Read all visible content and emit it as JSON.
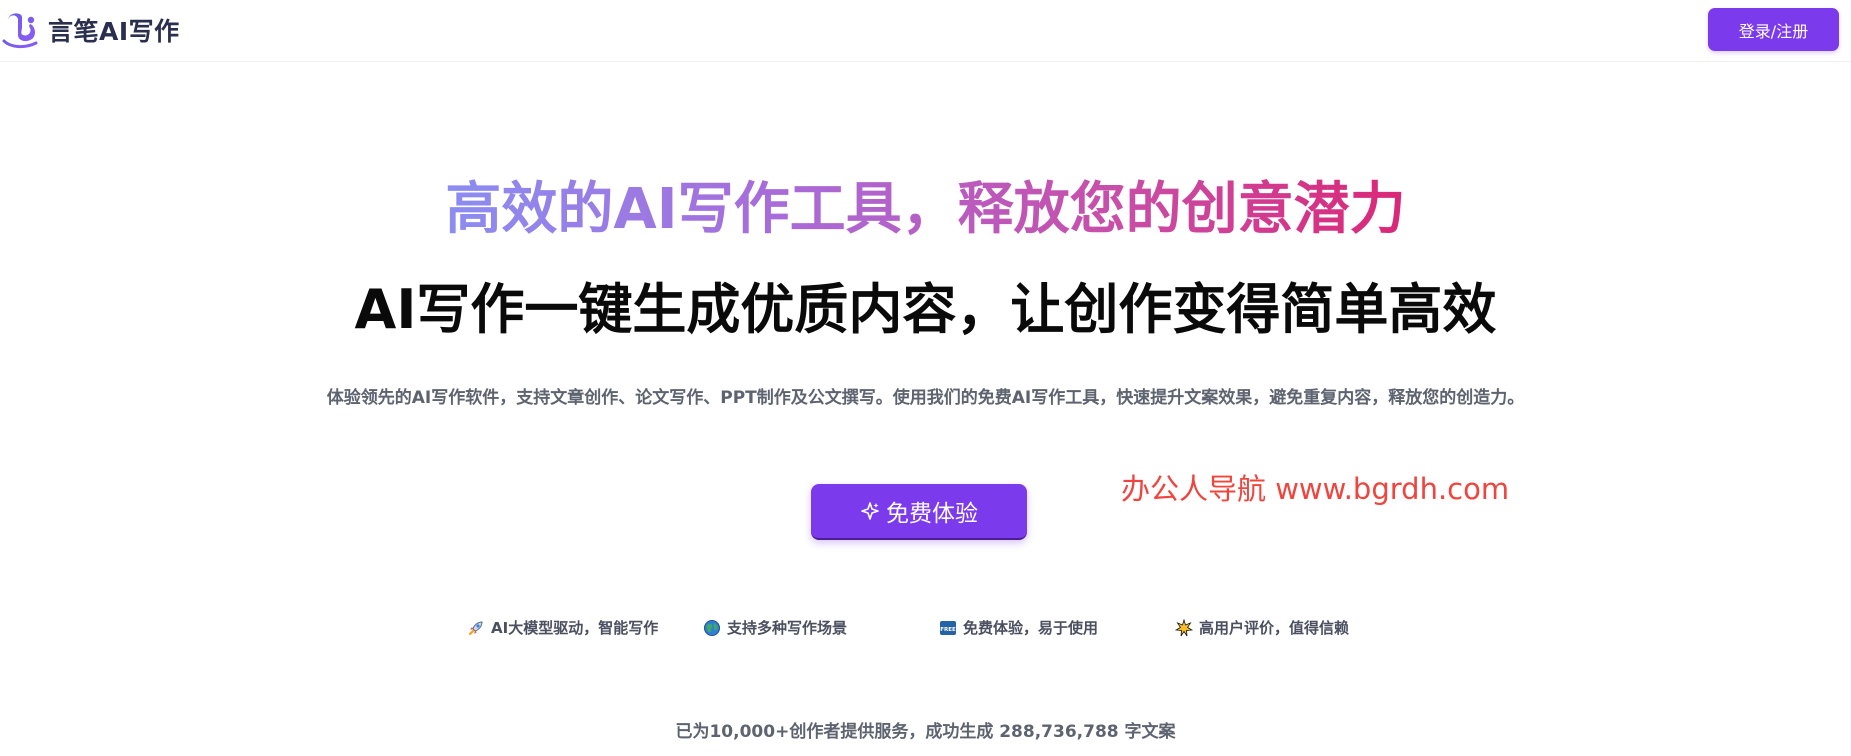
{
  "header": {
    "logo_text": "言笔AI写作",
    "login_label": "登录/注册"
  },
  "hero": {
    "title": "高效的AI写作工具，释放您的创意潜力",
    "subtitle": "AI写作一键生成优质内容，让创作变得简单高效",
    "description": "体验领先的AI写作软件，支持文章创作、论文写作、PPT制作及公文撰写。使用我们的免费AI写作工具，快速提升文案效果，避免重复内容，释放您的创造力。",
    "cta_label": "免费体验"
  },
  "watermark": "办公人导航 www.bgrdh.com",
  "features": [
    {
      "icon": "rocket-icon",
      "label": "AI大模型驱动，智能写作"
    },
    {
      "icon": "globe-icon",
      "label": "支持多种写作场景"
    },
    {
      "icon": "free-badge-icon",
      "label": "免费体验，易于使用"
    },
    {
      "icon": "star-burst-icon",
      "label": "高用户评价，值得信赖"
    }
  ],
  "stats": "已为10,000+创作者提供服务，成功生成 288,736,788 字文案",
  "colors": {
    "accent": "#7c3aed",
    "gradient_start": "#8b8df1",
    "gradient_end": "#db2777",
    "watermark": "#f0443e"
  }
}
